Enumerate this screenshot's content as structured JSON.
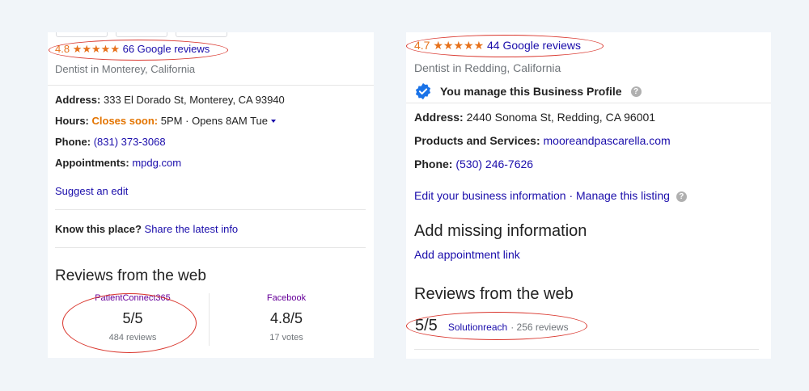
{
  "left": {
    "rating": "4.8",
    "stars": "★★★★★",
    "reviews_link": "66 Google reviews",
    "category": "Dentist in Monterey, California",
    "address_label": "Address:",
    "address_value": "333 El Dorado St, Monterey, CA 93940",
    "hours_label": "Hours:",
    "hours_status": "Closes soon:",
    "hours_close": "5PM",
    "hours_open": "· Opens 8AM Tue",
    "phone_label": "Phone:",
    "phone_value": "(831) 373-3068",
    "appointments_label": "Appointments:",
    "appointments_value": "mpdg.com",
    "suggest_edit": "Suggest an edit",
    "know_label": "Know this place?",
    "know_link": "Share the latest info",
    "reviews_heading": "Reviews from the web",
    "web_reviews": [
      {
        "source": "PatientConnect365",
        "score": "5/5",
        "count": "484 reviews"
      },
      {
        "source": "Facebook",
        "score": "4.8/5",
        "count": "17 votes"
      }
    ]
  },
  "right": {
    "rating": "4.7",
    "stars": "★★★★★",
    "reviews_link": "44 Google reviews",
    "category": "Dentist in Redding, California",
    "manage_text": "You manage this Business Profile",
    "address_label": "Address:",
    "address_value": "2440 Sonoma St, Redding, CA 96001",
    "products_label": "Products and Services:",
    "products_value": "mooreandpascarella.com",
    "phone_label": "Phone:",
    "phone_value": "(530) 246-7626",
    "edit_info": "Edit your business information",
    "manage_listing": "· Manage this listing",
    "missing_heading": "Add missing information",
    "add_appointment": "Add appointment link",
    "reviews_heading": "Reviews from the web",
    "web_score": "5/5",
    "web_source": "Solutionreach",
    "web_count": "· 256 reviews"
  },
  "colors": {
    "accent": "#e7711b",
    "link": "#1a0dab",
    "annotation": "#d9342b",
    "badge": "#1a73e8"
  }
}
